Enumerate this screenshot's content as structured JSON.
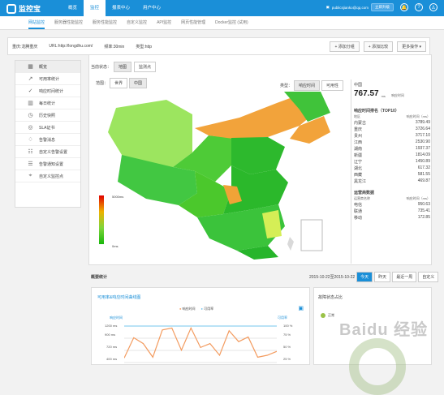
{
  "app": {
    "name": "监控宝",
    "nav": [
      "概览",
      "监控",
      "报表中心",
      "用户中心"
    ],
    "active_nav": "监控",
    "email": "publicsjianko@qq.com",
    "upgrade": "立即升级",
    "icons": [
      "bell-icon",
      "help-icon",
      "user-icon"
    ]
  },
  "tabs": [
    "网站监控",
    "服务器性能监控",
    "服务性能监控",
    "自定义监控",
    "API监控",
    "网页性能管理",
    "Docker监控 (试用)"
  ],
  "site": {
    "name_label": "重庆:龙腾重庆",
    "url_label": "URL:http://longdhu.com/",
    "freq_label": "频率:30min",
    "type_label": "类型:http"
  },
  "tools": [
    "+ 添加分组",
    "+ 添加比较",
    "更多操作 ▾"
  ],
  "sidebar": [
    {
      "label": "概览",
      "icon": "grid-icon"
    },
    {
      "label": "可用率统计",
      "icon": "line-chart-icon"
    },
    {
      "label": "响应时间统计",
      "icon": "check-icon"
    },
    {
      "label": "每日统计",
      "icon": "bar-chart-icon"
    },
    {
      "label": "历史快照",
      "icon": "clock-icon"
    },
    {
      "label": "SLA证书",
      "icon": "certificate-icon"
    },
    {
      "label": "告警消息",
      "icon": "bell-icon"
    },
    {
      "label": "自定义告警设置",
      "icon": "settings-icon"
    },
    {
      "label": "告警通知设置",
      "icon": "notice-icon"
    },
    {
      "label": "自定义监控点",
      "icon": "pin-icon"
    }
  ],
  "view": {
    "label": "当前状态：",
    "options": [
      "地图",
      "监测点"
    ],
    "selected": "地图"
  },
  "region": {
    "label": "范围：",
    "options": [
      "世界",
      "中国"
    ],
    "selected": "中国"
  },
  "metric": {
    "label": "类型：",
    "options": [
      "响应时间",
      "可用性"
    ],
    "selected": "响应时间"
  },
  "stats": {
    "country": "中国",
    "value": "767.57",
    "unit": "ms",
    "value_label": "响应时间",
    "top_title": "响应时间排名（TOP10）",
    "col1": "地区",
    "col2": "响应时间（ms）",
    "rows": [
      [
        "内蒙古",
        "3789.49"
      ],
      [
        "重庆",
        "3726.64"
      ],
      [
        "贵州",
        "3717.10"
      ],
      [
        "江西",
        "2530.90"
      ],
      [
        "湖南",
        "1937.37"
      ],
      [
        "新疆",
        "1814.09"
      ],
      [
        "辽宁",
        "1450.89"
      ],
      [
        "湖北",
        "617.32"
      ],
      [
        "西藏",
        "581.55"
      ],
      [
        "黑龙江",
        "469.87"
      ]
    ],
    "isp_title": "运营商数据",
    "isp_col1": "运营商名称",
    "isp_col2": "响应时间（ms）",
    "isp_rows": [
      [
        "电信",
        "950.63"
      ],
      [
        "联通",
        "735.41"
      ],
      [
        "移动",
        "172.85"
      ]
    ]
  },
  "legend": {
    "top": "5000ms",
    "bottom": "0ms"
  },
  "summary": {
    "title": "概要统计",
    "date": "2015-10-22至2015-10-22",
    "buttons": [
      "今天",
      "昨天",
      "最近一周",
      "自定义"
    ],
    "active_button": "今天"
  },
  "chart_data": {
    "type": "line",
    "title": "可用率&响应时间曲线图",
    "xlabel": "",
    "ylabel": "响应时间",
    "y2label": "可用率",
    "ylim": [
      0,
      1200
    ],
    "yticks": [
      "1200 ms",
      "900 ms",
      "720 ms",
      "400 ms"
    ],
    "y2ticks": [
      "100 %",
      "75 %",
      "50 %",
      "25 %"
    ],
    "series": [
      {
        "name": "响应时间",
        "values": [
          0.18,
          0.7,
          0.55,
          0.2,
          0.9,
          0.95,
          0.38,
          0.95,
          0.45,
          0.55,
          0.25,
          0.88,
          0.6,
          0.72,
          0.2,
          0.25,
          0.35
        ],
        "color": "#f39b5f"
      },
      {
        "name": "可用率",
        "values": [
          1,
          1,
          1,
          1,
          1,
          1,
          1,
          1,
          1,
          1,
          1,
          1,
          1,
          1,
          1,
          1,
          1
        ],
        "color": "#76c7ee"
      }
    ]
  },
  "pie": {
    "title": "故障状态占比",
    "legend": "正常",
    "color": "#9ac247"
  },
  "watermark": "Baidu 经验"
}
